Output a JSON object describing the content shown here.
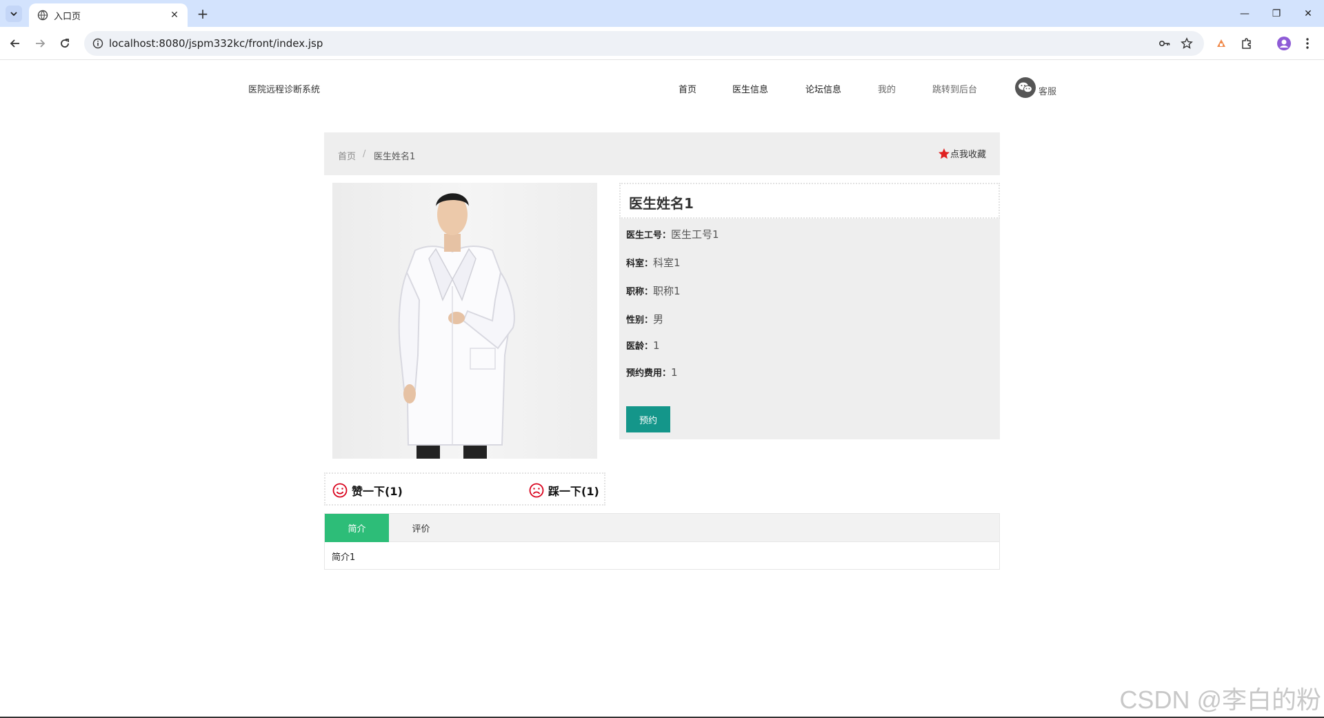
{
  "browser": {
    "tab_title": "入口页",
    "url": "localhost:8080/jspm332kc/front/index.jsp"
  },
  "header": {
    "site_title": "医院远程诊断系统",
    "nav": [
      "首页",
      "医生信息",
      "论坛信息",
      "我的",
      "跳转到后台"
    ],
    "service_label": "客服"
  },
  "breadcrumb": {
    "home": "首页",
    "separator": "/",
    "current": "医生姓名1",
    "favorite_label": "点我收藏"
  },
  "doctor": {
    "name": "医生姓名1",
    "fields": [
      {
        "key": "医生工号：",
        "value": "医生工号1"
      },
      {
        "key": "科室：",
        "value": "科室1"
      },
      {
        "key": "职称：",
        "value": "职称1"
      },
      {
        "key": "性别：",
        "value": "男"
      },
      {
        "key": "医龄：",
        "value": "1"
      },
      {
        "key": "预约费用：",
        "value": "1"
      }
    ],
    "book_label": "预约"
  },
  "votes": {
    "like_label": "赞一下(1)",
    "dislike_label": "踩一下(1)"
  },
  "tabs": {
    "items": [
      "简介",
      "评价"
    ],
    "active": "简介",
    "content": "简介1"
  },
  "watermark": "CSDN @李白的粉",
  "colors": {
    "accent_green": "#2dbd78",
    "button_teal": "#14968a",
    "star_red": "#e02020",
    "face_red": "#d9001b"
  }
}
